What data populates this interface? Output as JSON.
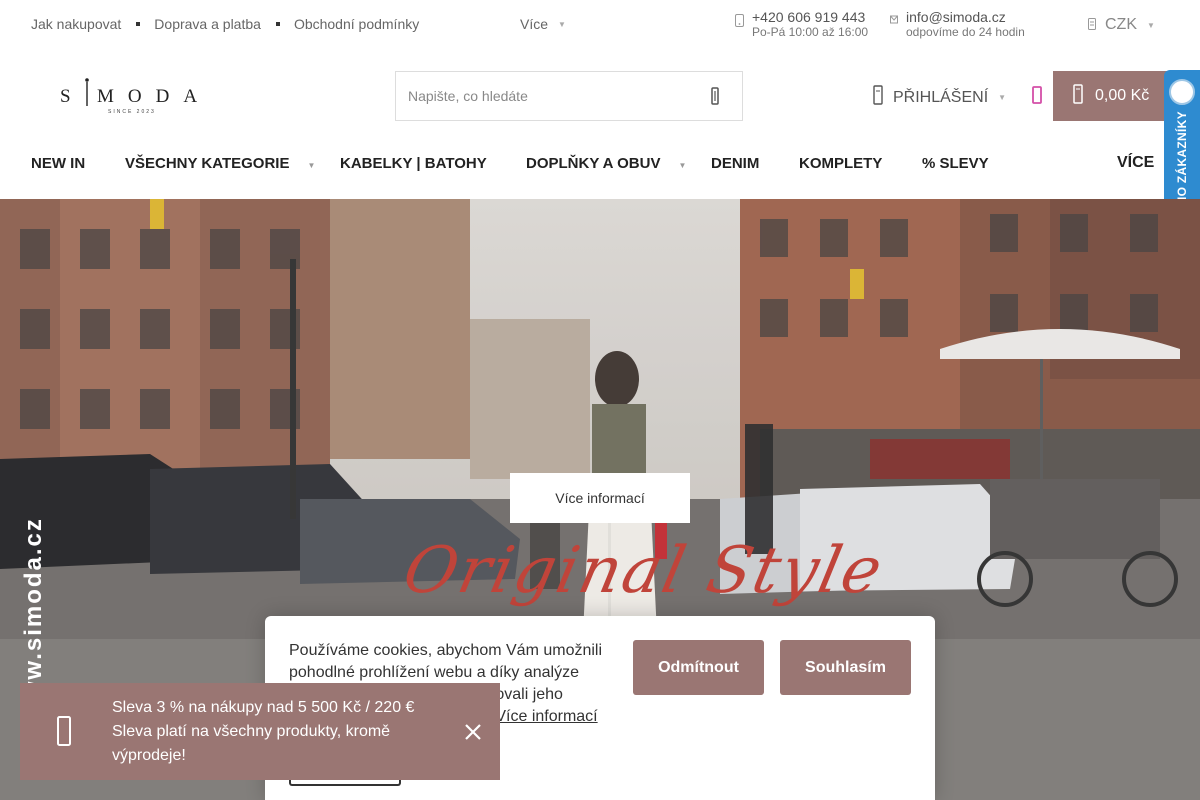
{
  "topbar": {
    "links": [
      "Jak nakupovat",
      "Doprava a platba",
      "Obchodní podmínky"
    ],
    "more": "Více",
    "phone": {
      "number": "+420 606 919 443",
      "hours": "Po-Pá 10:00 až 16:00"
    },
    "email": {
      "address": "info@simoda.cz",
      "note": "odpovíme do 24 hodin"
    },
    "currency": "CZK"
  },
  "header": {
    "logo": {
      "text": "S I M O D A",
      "sub": "SINCE 2023"
    },
    "search": {
      "placeholder": "Napište, co hledáte",
      "value": ""
    },
    "login": "PŘIHLÁŠENÍ",
    "cart_total": "0,00 Kč"
  },
  "nav": {
    "items": [
      {
        "label": "NEW IN",
        "has_dropdown": false
      },
      {
        "label": "VŠECHNY KATEGORIE",
        "has_dropdown": true
      },
      {
        "label": "KABELKY | BATOHY",
        "has_dropdown": false
      },
      {
        "label": "DOPLŇKY A OBUV",
        "has_dropdown": true
      },
      {
        "label": "DENIM",
        "has_dropdown": false
      },
      {
        "label": "KOMPLETY",
        "has_dropdown": false
      },
      {
        "label": "% SLEVY",
        "has_dropdown": false
      }
    ],
    "more": "VÍCE"
  },
  "badge": {
    "label": "OVĚŘENO ZÁKAZNÍKY"
  },
  "hero": {
    "button": "Více informací",
    "script": "Original Style",
    "watermark": "www.simoda.cz"
  },
  "cookie": {
    "text": "Používáme cookies, abychom Vám umožnili pohodlné prohlížení webu a díky analýze provozu webu neustále zlepšovali jeho funkce, výkon a bezpečnost.",
    "link": "Více informací",
    "decline": "Odmítnout",
    "accept": "Souhlasím"
  },
  "toast": {
    "line1": "Sleva 3 % na nákupy nad 5 500 Kč / 220 €",
    "line2": "Sleva platí na všechny produkty, kromě výprodeje!"
  },
  "colors": {
    "brand": "#9a7673",
    "accent_pink": "#d44fa8",
    "badge_blue": "#2e8bd0",
    "script_red": "#c0443a"
  }
}
